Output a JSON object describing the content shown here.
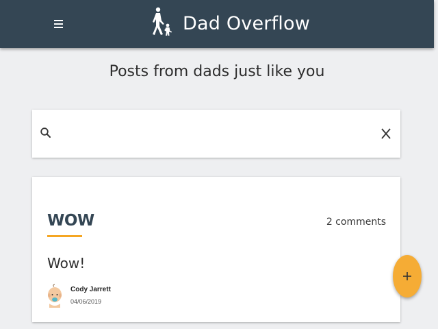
{
  "header": {
    "menu_icon": "hamburger-menu-icon",
    "logo_icon": "dad-walking-with-child-icon",
    "title": "Dad Overflow",
    "background": "#344654"
  },
  "page": {
    "heading": "Posts from dads just like you",
    "background": "#eeeff1"
  },
  "search": {
    "icon": "search-icon",
    "value": "",
    "placeholder": "",
    "clear_icon": "close-icon"
  },
  "posts": [
    {
      "title": "WOW",
      "comments": "2 comments",
      "body": "Wow!",
      "author": "Cody Jarrett",
      "date": "04/06/2019",
      "avatar_icon": "baby-avatar-icon"
    }
  ],
  "fab": {
    "icon": "plus-icon",
    "color": "#f5ac35"
  },
  "accent_color": "#f5a623"
}
